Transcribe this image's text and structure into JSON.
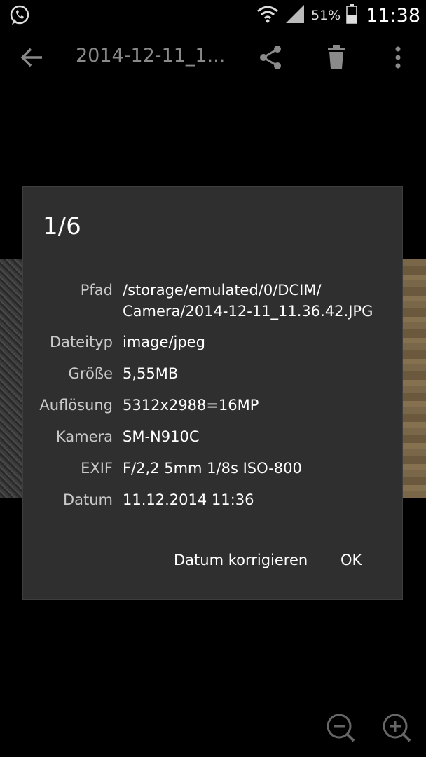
{
  "status_bar": {
    "app_icon": "whatsapp-icon",
    "battery": "51%",
    "time": "11:38"
  },
  "toolbar": {
    "title": "2014-12-11_1...",
    "back_icon": "arrow-back-icon",
    "share_icon": "share-icon",
    "delete_icon": "trash-icon",
    "more_icon": "more-vert-icon"
  },
  "dialog": {
    "title": "1/6",
    "rows": [
      {
        "label": "Pfad",
        "value": "/storage/emulated/0/DCIM/\nCamera/2014-12-11_11.36.42.JPG"
      },
      {
        "label": "Dateityp",
        "value": "image/jpeg"
      },
      {
        "label": "Größe",
        "value": "5,55MB"
      },
      {
        "label": "Auflösung",
        "value": "5312x2988=16MP"
      },
      {
        "label": "Kamera",
        "value": "SM-N910C"
      },
      {
        "label": "EXIF",
        "value": "F/2,2 5mm 1/8s ISO-800"
      },
      {
        "label": "Datum",
        "value": "11.12.2014 11:36"
      }
    ],
    "buttons": {
      "fix_date": "Datum korrigieren",
      "ok": "OK"
    }
  },
  "zoom": {
    "out_icon": "zoom-out-icon",
    "in_icon": "zoom-in-icon"
  }
}
